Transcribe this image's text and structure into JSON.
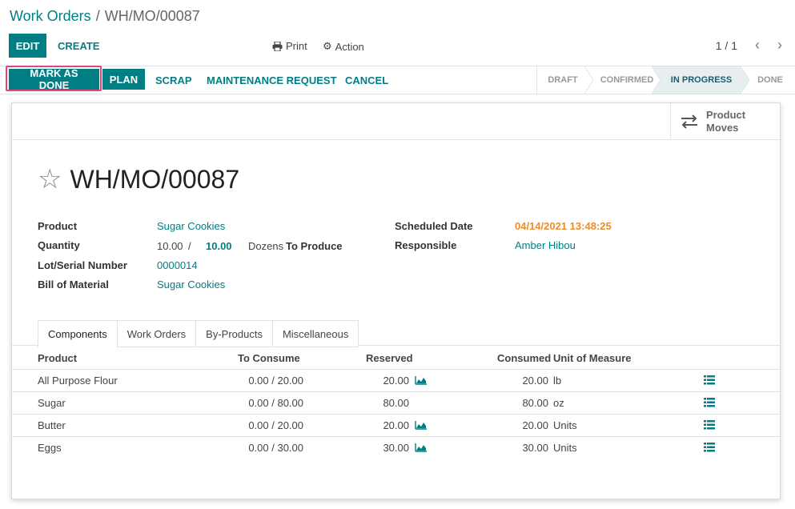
{
  "breadcrumb": {
    "parent": "Work Orders",
    "separator": "/",
    "current": "WH/MO/00087"
  },
  "control_panel": {
    "edit_label": "EDIT",
    "create_label": "CREATE",
    "print_label": "Print",
    "action_label": "Action",
    "pager": "1 / 1"
  },
  "statusbar": {
    "buttons": {
      "mark_done": "MARK AS DONE",
      "plan": "PLAN",
      "scrap": "SCRAP",
      "maintenance": "MAINTENANCE REQUEST",
      "cancel": "CANCEL"
    },
    "stages": [
      "DRAFT",
      "CONFIRMED",
      "IN PROGRESS",
      "DONE"
    ],
    "active_stage": "IN PROGRESS"
  },
  "smart_button": {
    "line1": "Product",
    "line2": "Moves"
  },
  "record": {
    "title": "WH/MO/00087",
    "labels": {
      "product": "Product",
      "quantity": "Quantity",
      "lot": "Lot/Serial Number",
      "bom": "Bill of Material",
      "scheduled_date": "Scheduled Date",
      "responsible": "Responsible",
      "to_produce": "To Produce"
    },
    "product": "Sugar Cookies",
    "qty_produced": "10.00",
    "qty_sep": "/",
    "qty_total": "10.00",
    "uom": "Dozens",
    "lot": "0000014",
    "bom": "Sugar Cookies",
    "scheduled_date": "04/14/2021 13:48:25",
    "responsible": "Amber Hibou"
  },
  "tabs": [
    "Components",
    "Work Orders",
    "By-Products",
    "Miscellaneous"
  ],
  "table": {
    "headers": {
      "product": "Product",
      "to_consume": "To Consume",
      "reserved": "Reserved",
      "consumed": "Consumed",
      "uom": "Unit of Measure"
    },
    "rows": [
      {
        "product": "All Purpose Flour",
        "to_consume": "0.00 / 20.00",
        "reserved": "20.00",
        "consumed": "20.00",
        "uom": "lb",
        "forecast_icon": true
      },
      {
        "product": "Sugar",
        "to_consume": "0.00 / 80.00",
        "reserved": "80.00",
        "consumed": "80.00",
        "uom": "oz",
        "forecast_icon": false
      },
      {
        "product": "Butter",
        "to_consume": "0.00 / 20.00",
        "reserved": "20.00",
        "consumed": "20.00",
        "uom": "Units",
        "forecast_icon": true
      },
      {
        "product": "Eggs",
        "to_consume": "0.00 / 30.00",
        "reserved": "30.00",
        "consumed": "30.00",
        "uom": "Units",
        "forecast_icon": true
      }
    ]
  },
  "colors": {
    "accent": "#017e84",
    "orange": "#e88f2b",
    "highlight": "#e0457b",
    "active_stage_bg": "#e7eef0"
  }
}
